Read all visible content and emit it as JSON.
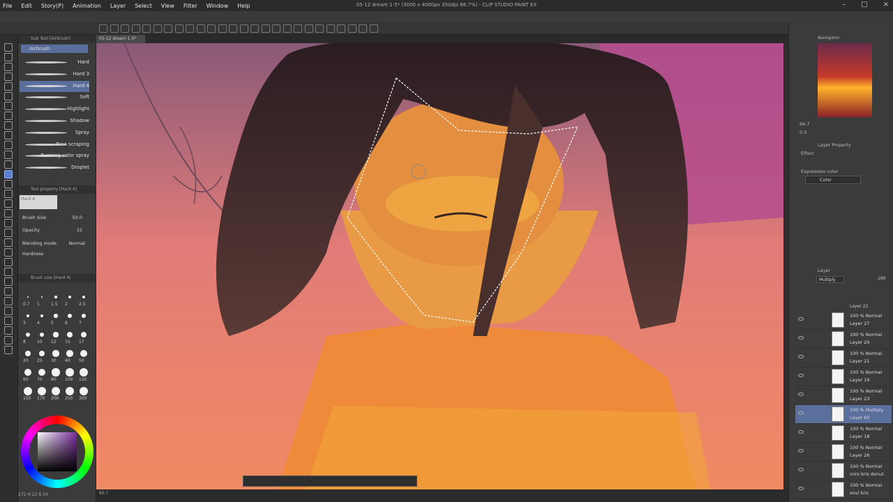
{
  "menu": [
    "File",
    "Edit",
    "Story(P)",
    "Animation",
    "Layer",
    "Select",
    "View",
    "Filter",
    "Window",
    "Help"
  ],
  "window_title": "05-12 dream 1-5* (3000 x 4000px 350dpi 66.7%) - CLIP STUDIO PAINT EX",
  "document_tab": "05-12 dream 1-5*",
  "sub_tool": {
    "header": "Sub Tool [Airbrush]",
    "group": "Airbrush",
    "items": [
      "Hard",
      "Hard 3",
      "Hard 4",
      "Soft",
      "Highlight",
      "Shadow",
      "Spray",
      "Tone scraping",
      "Running color spray",
      "Droplet"
    ],
    "selected": "Hard 4"
  },
  "tool_property": {
    "header": "Tool property [Hard 4]",
    "preset": "Hard 4",
    "brush_size_label": "Brush Size",
    "brush_size": "50.0",
    "opacity_label": "Opacity",
    "opacity": "15",
    "blending_label": "Blending mode",
    "blending": "Normal",
    "hardness_label": "Hardness"
  },
  "brush_size_panel": {
    "header": "Brush size [Hard 4]",
    "rows": [
      [
        "0.7",
        "1",
        "1.5",
        "2",
        "2.5"
      ],
      [
        "3",
        "4",
        "5",
        "6",
        "7"
      ],
      [
        "8",
        "10",
        "12",
        "15",
        "17"
      ],
      [
        "20",
        "25",
        "30",
        "40",
        "50"
      ],
      [
        "60",
        "70",
        "80",
        "100",
        "120"
      ],
      [
        "150",
        "170",
        "200",
        "250",
        "300"
      ]
    ]
  },
  "left_status": "272 H 22 8 34",
  "navigator": {
    "header": "Navigator",
    "zoom": "66.7",
    "rotation": "0.0"
  },
  "layer_property": {
    "header": "Layer Property",
    "effect": "Effect",
    "expression_label": "Expression color",
    "expression": "Color"
  },
  "layer_panel": {
    "header": "Layer",
    "blend": "Multiply",
    "opacity": "100",
    "top_partial": "Layer 22",
    "layers": [
      {
        "mode": "100 % Normal",
        "name": "Layer 27"
      },
      {
        "mode": "100 % Normal",
        "name": "Layer 20"
      },
      {
        "mode": "100 % Normal",
        "name": "Layer 21"
      },
      {
        "mode": "100 % Normal",
        "name": "Layer 19"
      },
      {
        "mode": "100 % Normal",
        "name": "Layer 23"
      },
      {
        "mode": "100 % Multiply",
        "name": "Layer 60",
        "selected": true
      },
      {
        "mode": "100 % Normal",
        "name": "Layer 18"
      },
      {
        "mode": "100 % Normal",
        "name": "Layer 26"
      },
      {
        "mode": "100 % Normal",
        "name": "mini kris donut"
      },
      {
        "mode": "100 % Normal",
        "name": "soul kris"
      },
      {
        "mode": "100 % Normal",
        "name": ""
      }
    ]
  },
  "canvas_status": "66.7",
  "colors": {
    "accent": "#5b6f9c",
    "panel": "#3b3b3b"
  }
}
